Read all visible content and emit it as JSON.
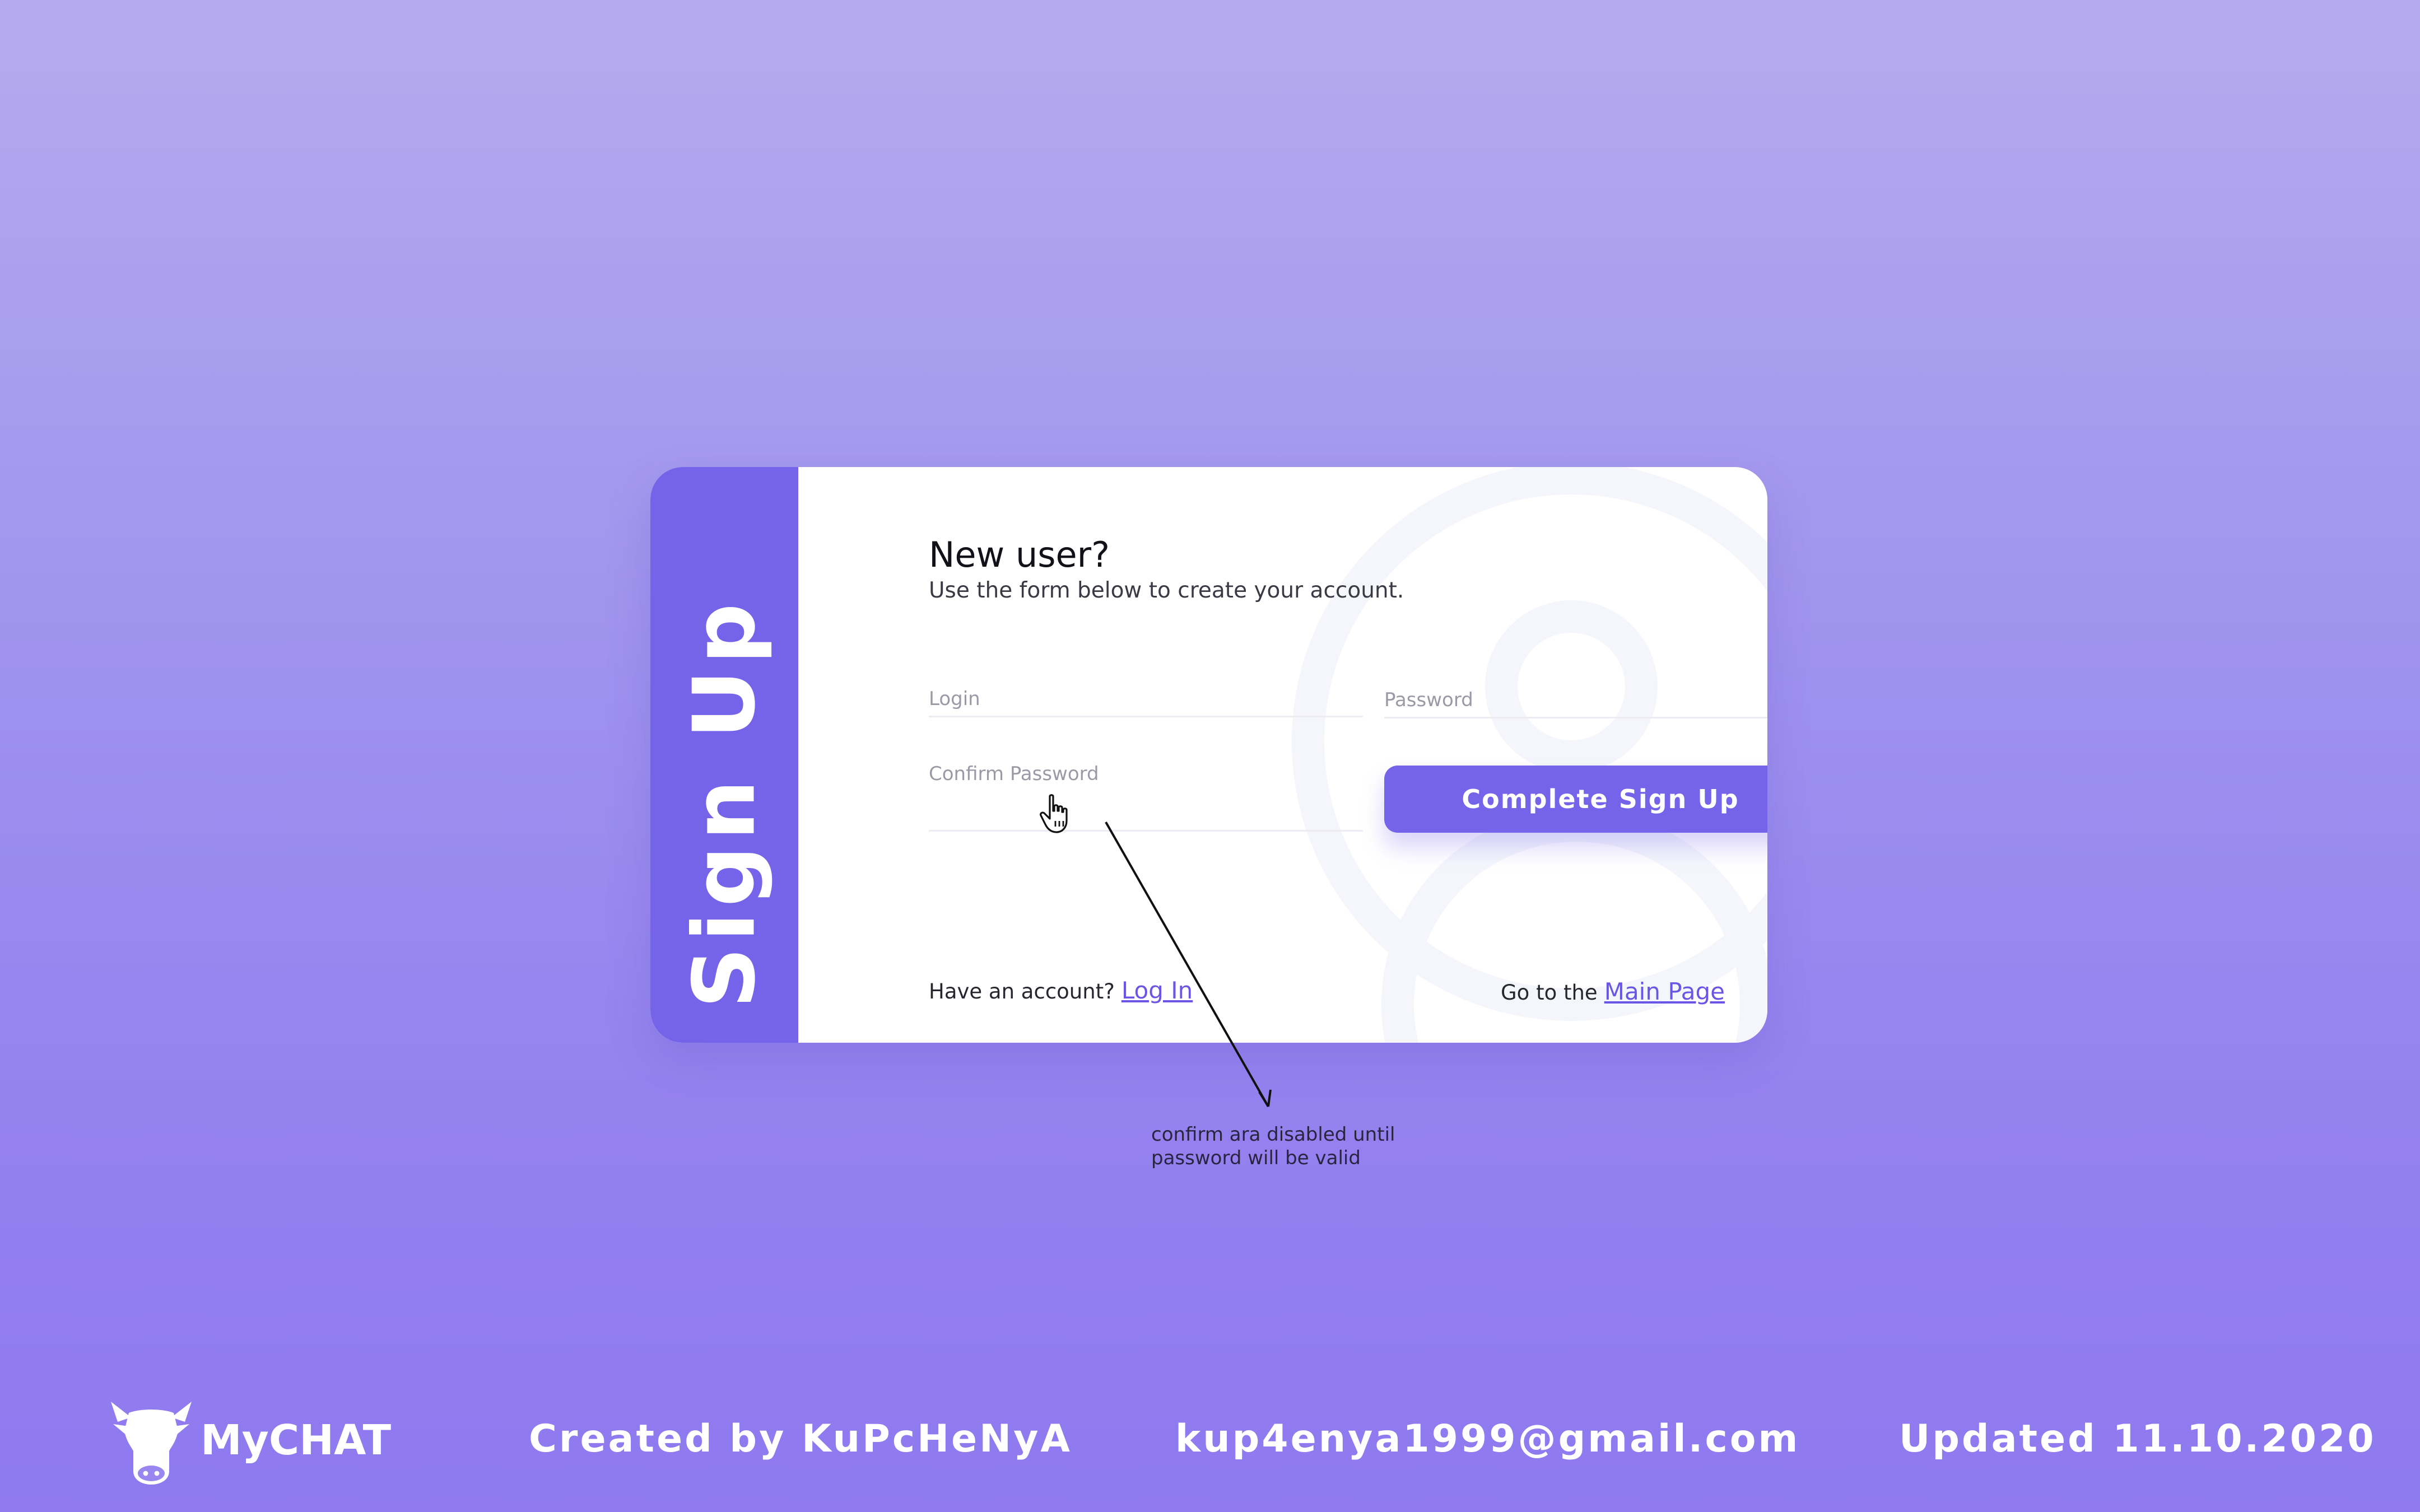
{
  "colors": {
    "accent": "#7563ea",
    "background_top": "#b6aaee",
    "background_bottom": "#8e79ef",
    "link": "#6a55e6"
  },
  "card": {
    "side_title": "Sign Up",
    "heading": "New user?",
    "subheading": "Use the form below to create your account.",
    "fields": {
      "login": {
        "placeholder": "Login",
        "value": ""
      },
      "password": {
        "placeholder": "Password",
        "value": ""
      },
      "confirm_password": {
        "placeholder": "Confirm Password",
        "value": ""
      }
    },
    "submit_label": "Complete Sign Up",
    "footer_left": {
      "text": "Have an account?",
      "link": "Log In"
    },
    "footer_right": {
      "text": "Go to the",
      "link": "Main Page"
    }
  },
  "annotation": {
    "line1": "confirm ara disabled until",
    "line2": "password will be valid"
  },
  "bottom_bar": {
    "brand": "MyCHAT",
    "created": "Created by KuPcHeNyA",
    "email": "kup4enya1999@gmail.com",
    "updated": "Updated 11.10.2020"
  },
  "icons": {
    "cursor": "hand-pointer-icon",
    "logo": "cow-head-logo",
    "background": "user-silhouette-icon"
  }
}
